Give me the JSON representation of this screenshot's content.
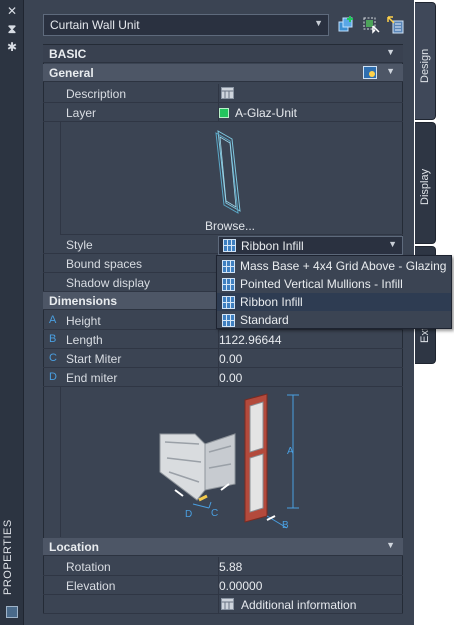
{
  "window": {
    "title": "PROPERTIES",
    "tabs": [
      "Design",
      "Display",
      "Extended Data"
    ]
  },
  "header": {
    "object_type": "Curtain Wall Unit",
    "buttons": [
      "add-selection-icon",
      "quick-select-icon",
      "toggle-pickadd-icon"
    ]
  },
  "categories": {
    "basic": "BASIC",
    "general": "General",
    "dimensions": "Dimensions",
    "location": "Location"
  },
  "general": {
    "description_label": "Description",
    "layer_label": "Layer",
    "layer_value": "A-Glaz-Unit",
    "layer_color": "#22c55e",
    "browse": "Browse...",
    "style_label": "Style",
    "style_value": "Ribbon Infill",
    "bound_spaces_label": "Bound spaces",
    "shadow_display_label": "Shadow display"
  },
  "style_options": [
    "Mass Base + 4x4 Grid Above - Glazing",
    "Pointed Vertical Mullions - Infill",
    "Ribbon Infill",
    "Standard"
  ],
  "dimensions": {
    "rows": [
      {
        "letter": "A",
        "label": "Height",
        "value": ""
      },
      {
        "letter": "B",
        "label": "Length",
        "value": "1122.96644"
      },
      {
        "letter": "C",
        "label": "Start Miter",
        "value": "0.00"
      },
      {
        "letter": "D",
        "label": "End miter",
        "value": "0.00"
      }
    ],
    "diagram_labels": {
      "a": "A",
      "b": "B",
      "c": "C",
      "d": "D"
    }
  },
  "location": {
    "rotation_label": "Rotation",
    "rotation_value": "5.88",
    "elevation_label": "Elevation",
    "elevation_value": "0.00000",
    "additional": "Additional information"
  },
  "colors": {
    "accent_letter": "#4a9fe0",
    "panel_bg": "#3b4453"
  }
}
